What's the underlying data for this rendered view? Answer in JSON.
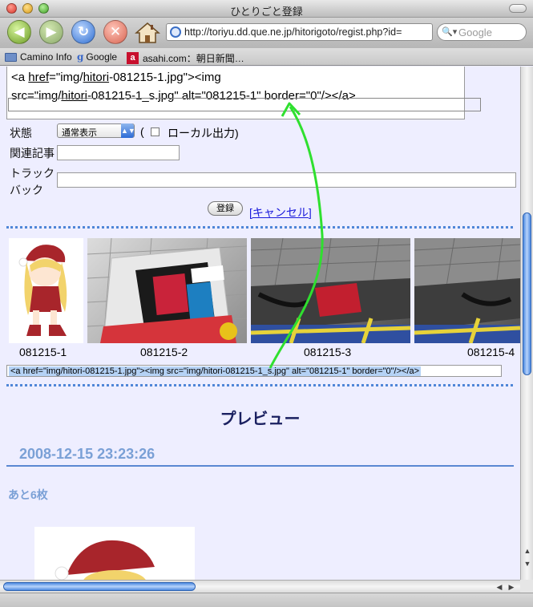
{
  "window": {
    "title": "ひとりごと登録"
  },
  "toolbar": {
    "url": "http://toriyu.dd.que.ne.jp/hitorigoto/regist.php?id=",
    "search_placeholder": "Google"
  },
  "bookmarks": [
    {
      "label": "Camino Info",
      "icon": "folder-icon"
    },
    {
      "label": "Google",
      "icon": "google-g-icon"
    },
    {
      "label": "asahi.com：朝日新聞…",
      "icon": "asahi-icon"
    }
  ],
  "editor": {
    "line1_prefix": "<a ",
    "line1_href": "href",
    "line1_rest": "=\"img/",
    "line1_hitori": "hitori",
    "line1_tail": "-081215-1.jpg\"><img",
    "line2_src": "src=\"img/",
    "line2_hitori": "hitori",
    "line2_tail": "-081215-1_s.jpg\" alt=\"081215-1\" border=\"0\"/></a>"
  },
  "form": {
    "status_label": "状態",
    "status_value": "通常表示",
    "paren_open": "(",
    "local_output_label": "ローカル出力)",
    "related_label": "関連記事",
    "trackback_label_1": "トラック",
    "trackback_label_2": "バック",
    "submit_label": "登録",
    "cancel_label": "[キャンセル]"
  },
  "thumbnails": [
    {
      "caption": "081215-1"
    },
    {
      "caption": "081215-2"
    },
    {
      "caption": "081215-3"
    },
    {
      "caption": "081215-4"
    }
  ],
  "selected_code": "<a href=\"img/hitori-081215-1.jpg\"><img src=\"img/hitori-081215-1_s.jpg\" alt=\"081215-1\" border=\"0\"/></a>",
  "preview": {
    "heading": "プレビュー",
    "date": "2008-12-15 23:23:26",
    "remaining": "あと6枚"
  },
  "colors": {
    "arrow": "#2fe02f",
    "link": "#1a1adb",
    "accent": "#4f86d8"
  }
}
